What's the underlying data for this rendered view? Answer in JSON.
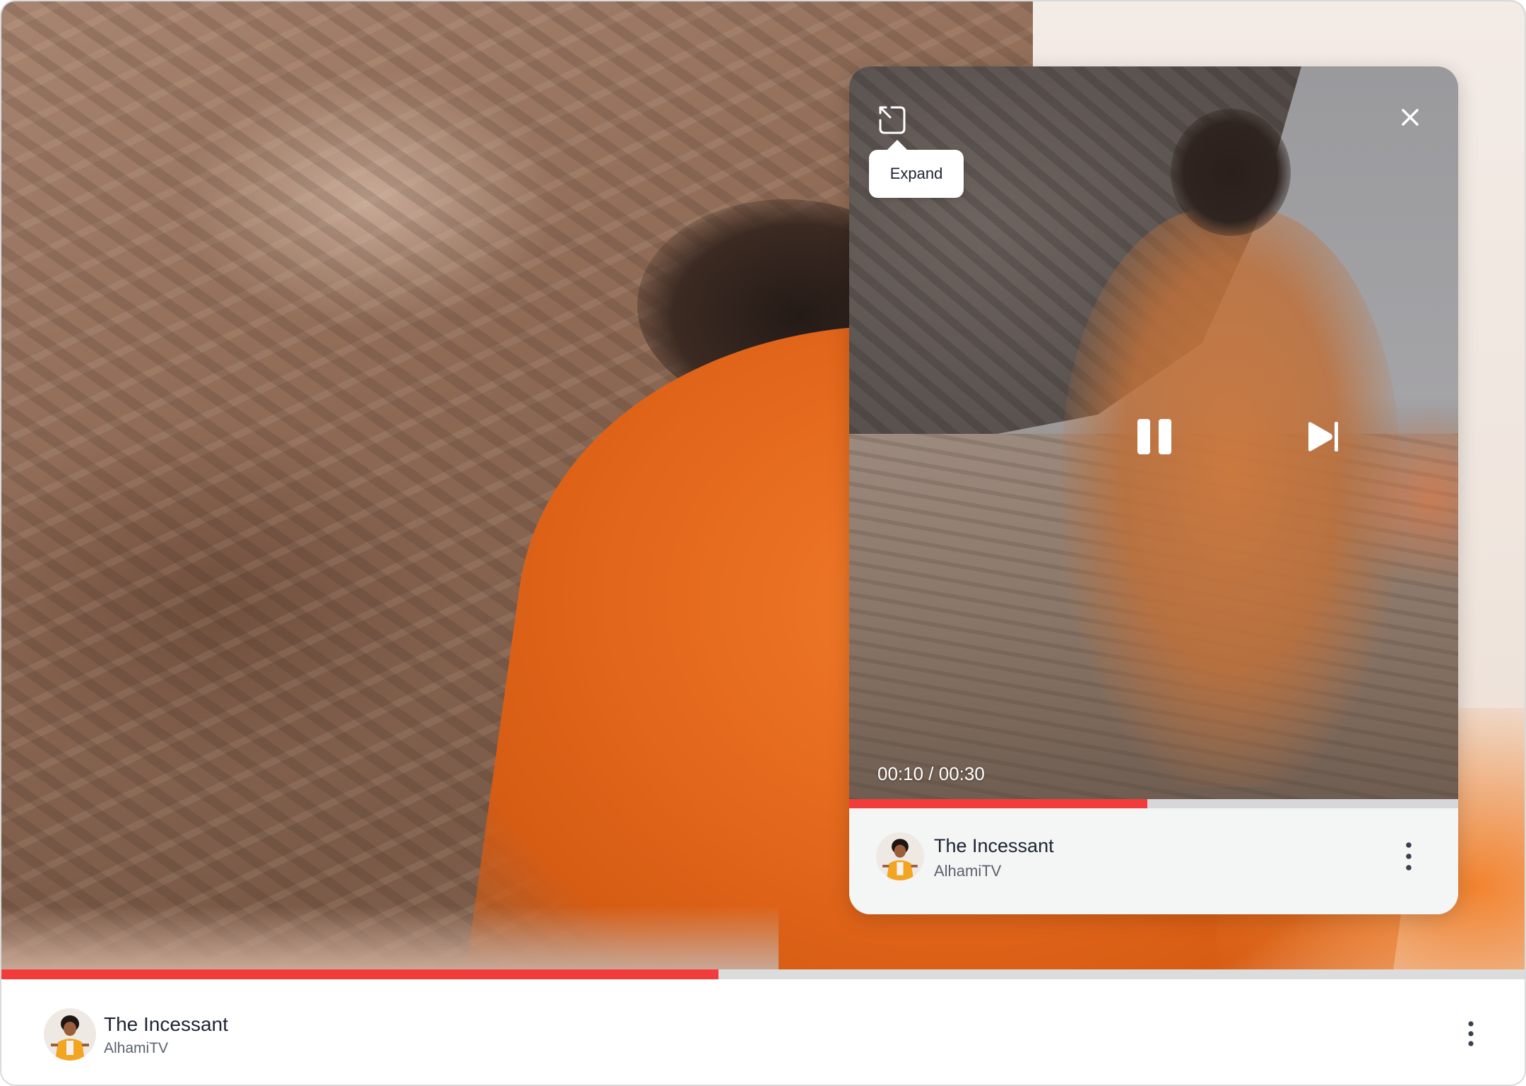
{
  "main_player": {
    "progress_fraction": 0.47,
    "title": "The Incessant",
    "channel": "AlhamiTV",
    "avatar_icon": "avatar",
    "more_icon": "more-vertical-icon"
  },
  "mini_player": {
    "expand_icon": "expand-icon",
    "close_icon": "close-icon",
    "tooltip": "Expand",
    "pause_icon": "pause-icon",
    "next_icon": "skip-next-icon",
    "time": "00:10 / 00:30",
    "progress_fraction": 0.49,
    "title": "The Incessant",
    "channel": "AlhamiTV",
    "avatar_icon": "avatar",
    "more_icon": "more-vertical-icon"
  },
  "colors": {
    "progress_played": "#f23c3c",
    "progress_track": "#dcdcdc",
    "title_text": "#1e2533",
    "subtitle_text": "#5b6170"
  }
}
